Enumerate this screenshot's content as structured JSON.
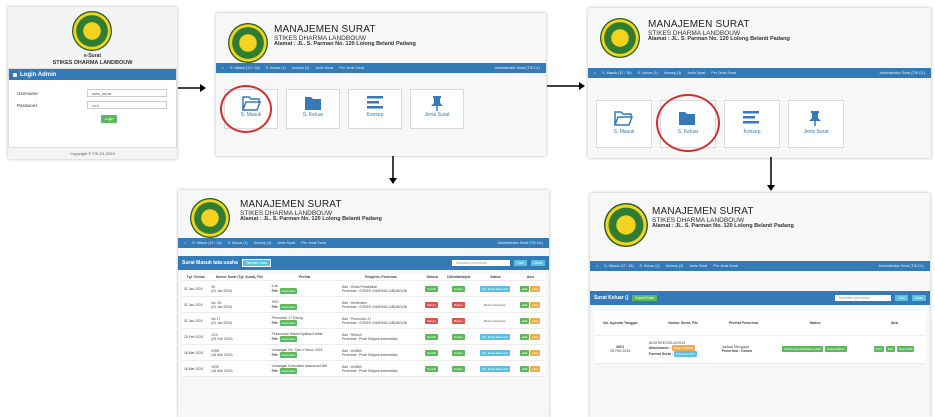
{
  "login": {
    "brand_line1": "e-Surat",
    "brand_line2": "STIKES DHARMA LANDBOUW",
    "header": "Login Admin",
    "username_label": "Username",
    "username_value": "adm_surat",
    "password_label": "Password",
    "password_value": "•••••",
    "login_button": "Login",
    "copyright": "Copyright © TIK-DL 2024"
  },
  "header": {
    "title": "MANAJEMEN SURAT",
    "subtitle": "STIKES DHARMA LANDBOUW",
    "address": "Alamat : JL. S. Parman No. 120 Lolong Belanti Padang"
  },
  "nav": {
    "surat_masuk": "S. Masuk (12 / 18)",
    "surat_keluar": "S. Keluar (1)",
    "konsep": "Konsep (3)",
    "jenis_surat": "Jenis Surat",
    "per_jenis": "Per Jenis Surat",
    "admin": "Administrator Surat (TIK-DL)"
  },
  "tiles": {
    "masuk": "S. Masuk",
    "keluar": "S. Keluar",
    "konsep": "Konsep",
    "jenis": "Jenis Surat"
  },
  "masuk_page": {
    "title": "Surat Masuk tata usaha",
    "add_button": "Tambah Data",
    "search_placeholder": "Masukan pencarian...",
    "cari": "Cari",
    "clear": "Clear",
    "columns": [
      "Tgl. Terima",
      "Nomor Surat (Tgl. Surat), File",
      "Perihal",
      "Pengirim, Penerima",
      "Dibaca",
      "Ditindaklanjuti",
      "Status",
      "Aksi"
    ],
    "rows": [
      {
        "date": "01 Jan 2024",
        "no": "28",
        "tgl": "(01 Jan 2024)",
        "perihal": "e-sk",
        "file": "File:",
        "pengirim": "Dari : Dinas Pendidikan",
        "penerima": "Penerima : STIKES DHARMA LANDBOUW",
        "dibaca": "Sudah",
        "tindak": "Sudah",
        "status": "Lih. Surat Disposisi"
      },
      {
        "date": "01 Jan 2024",
        "no": "No. 26",
        "tgl": "(01 Jan 2024)",
        "perihal": "SKD",
        "file": "File:",
        "pengirim": "Dari : Kemenkes",
        "penerima": "Penerima : STIKES DHARMA LANDBOUW",
        "dibaca": "Belum",
        "tindak": "Belum",
        "status": "Belum Disposisi"
      },
      {
        "date": "01 Jan 2024",
        "no": "No 17",
        "tgl": "(01 Jan 2024)",
        "perihal": "Permohon 17 Tolong",
        "file": "File:",
        "pengirim": "Dari : Permohon 17",
        "penerima": "Penerima : STIKES DHARMA LANDBOUW",
        "dibaca": "Belum",
        "tindak": "Belum",
        "status": "Belum Disposisi"
      },
      {
        "date": "25 Feb 2024",
        "no": "1/10",
        "tgl": "(25 Feb 2024)",
        "perihal": "Peluncuran Sistem Aplikasi Hebat",
        "file": "File:",
        "pengirim": "Dari : Rektori",
        "penerima": "Penerima : Prodi Sarjana Informatika",
        "dibaca": "Sudah",
        "tindak": "Sudah",
        "status": "Lih. Surat Disposisi"
      },
      {
        "date": "18 Mar 2024",
        "no": "0498",
        "tgl": "(18 Mar 2024)",
        "perihal": "Undangan Ms. Tjas n Tahun 2024",
        "file": "File:",
        "pengirim": "Dari : UNIMS",
        "penerima": "Penerima : Prodi Sarjana Informatika",
        "dibaca": "Sudah",
        "tindak": "Sudah",
        "status": "Lih. Surat Disposisi"
      },
      {
        "date": "18 Mar 2024",
        "no": "1033",
        "tgl": "(18 Mar 2024)",
        "perihal": "Undangan Konsultasi Indonesia Dikti",
        "file": "File:",
        "pengirim": "Dari : UNIMS",
        "penerima": "Penerima : Prodi Sarjana Informatika",
        "dibaca": "Sudah",
        "tindak": "Sudah",
        "status": "Lih. Surat Disposisi"
      }
    ],
    "file_btn": "Download",
    "aksi_edit": "Edit",
    "aksi_hapus": "Hps"
  },
  "keluar_page": {
    "title": "Surat Keluar ()",
    "export_button": "Export Data",
    "search_placeholder": "Masukan pencarian...",
    "cari": "Cari",
    "clear": "Clear",
    "columns": [
      "No. Agenda Tanggal",
      "Nomor Surat, File",
      "Perihal Penerima",
      "Status",
      "Aksi"
    ],
    "row": {
      "agenda": "0001",
      "tanggal": "26 Feb 2024",
      "nomor": "DD/STIKES/DL/II/2024",
      "attachment_label": "Attachment :",
      "attachment_btn": "Lihat Lampiran",
      "format_label": "Format Surat :",
      "format_btn": "Download Pdf",
      "perihal": "Jadwal Mengajar",
      "penerima": "Penerima : Dosen",
      "status1": "Sudah diperiksa/diacc wakil",
      "status2": "Sudah dikirim",
      "aksi1": "Print",
      "aksi2": "Edit",
      "aksi3": "Buat Draft"
    }
  },
  "colors": {
    "navbar": "#337ab7",
    "login_header": "#337ab7",
    "success": "#5cb85c",
    "danger": "#d9534f",
    "warning": "#f0ad4e",
    "info": "#5bc0de",
    "highlight": "#d32f2f"
  }
}
